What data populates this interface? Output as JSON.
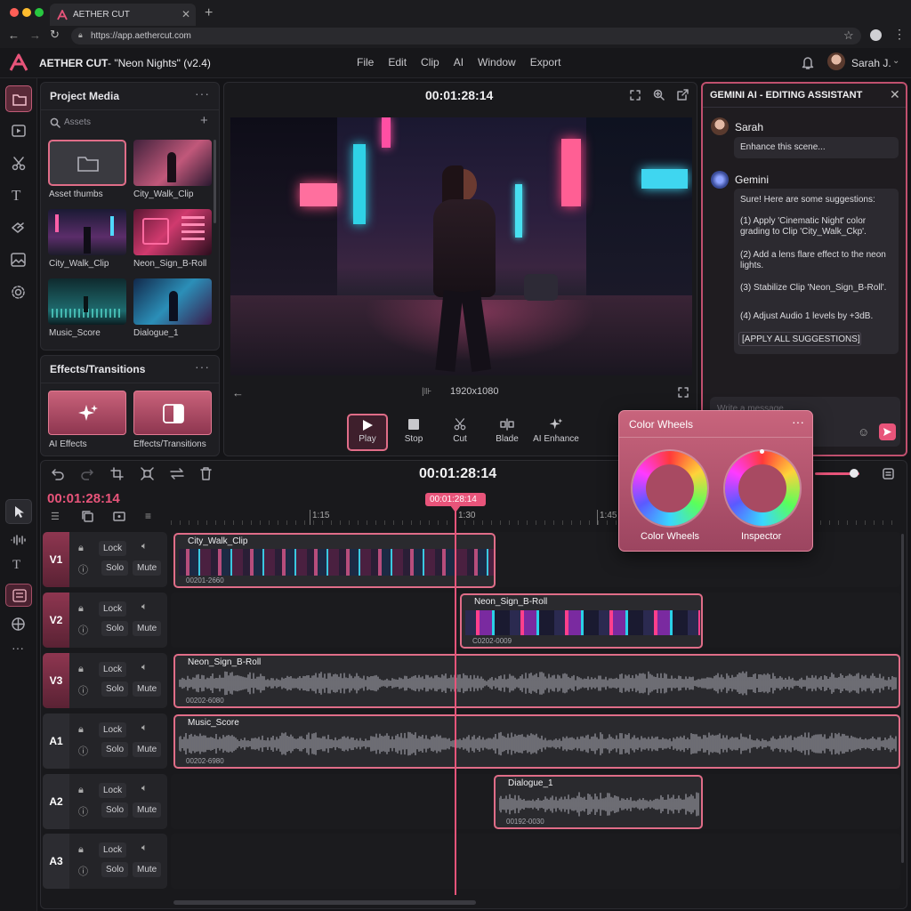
{
  "browser": {
    "tab_title": "AETHER CUT",
    "url": "https://app.aethercut.com"
  },
  "app": {
    "name": "AETHER CUT",
    "project": "- \"Neon Nights\" (v2.4)",
    "menu": [
      "File",
      "Edit",
      "Clip",
      "AI",
      "Window",
      "Export"
    ],
    "user": "Sarah J."
  },
  "media": {
    "title": "Project Media",
    "search_placeholder": "Assets",
    "items": [
      "Asset thumbs",
      "City_Walk_Clip",
      "City_Walk_Clip",
      "Neon_Sign_B-Roll",
      "Music_Score",
      "Dialogue_1"
    ]
  },
  "effects": {
    "title": "Effects/Transitions",
    "items": [
      "AI Effects",
      "Effects/Transitions"
    ]
  },
  "preview": {
    "timecode": "00:01:28:14",
    "resolution": "1920x1080",
    "controls": [
      "Play",
      "Stop",
      "Cut",
      "Blade",
      "AI Enhance"
    ]
  },
  "assistant": {
    "title": "GEMINI AI - EDITING ASSISTANT",
    "user_name": "Sarah",
    "user_msg": "Enhance this scene...",
    "bot_name": "Gemini",
    "bot_intro": "Sure! Here are some suggestions:",
    "suggestions": [
      "(1) Apply 'Cinematic Night' color grading to Clip 'City_Walk_Ckp'.",
      "(2) Add a lens flare effect to the neon lights.",
      "(3) Stabilize Clip 'Neon_Sign_B-Roll'.",
      "(4) Adjust Audio 1 levels by +3dB."
    ],
    "apply_all": "[APPLY ALL SUGGESTIONS]",
    "input_placeholder": "Write a message..."
  },
  "colorwheels": {
    "title": "Color Wheels",
    "wheel_labels": [
      "Color Wheels",
      "Inspector"
    ]
  },
  "timeline": {
    "timecode": "00:01:28:14",
    "current": "00:01:28:14",
    "playhead": "00:01:28:14",
    "ruler": [
      "1:15",
      "1:30",
      "1:45"
    ],
    "tracks": [
      {
        "name": "V1",
        "lock": "Lock",
        "solo": "Solo",
        "mute": "Mute"
      },
      {
        "name": "V2",
        "lock": "Lock",
        "solo": "Solo",
        "mute": "Mute"
      },
      {
        "name": "V3",
        "lock": "Lock",
        "solo": "Solo",
        "mute": "Mute"
      },
      {
        "name": "A1",
        "lock": "Lock",
        "solo": "Solo",
        "mute": "Mute"
      },
      {
        "name": "A2",
        "lock": "Lock",
        "solo": "Solo",
        "mute": "Mute"
      },
      {
        "name": "A3",
        "lock": "Lock",
        "solo": "Solo",
        "mute": "Mute"
      }
    ],
    "clips": [
      {
        "name": "City_Walk_Clip",
        "code": "00201-2660"
      },
      {
        "name": "Neon_Sign_B-Roll",
        "code": "C0202-0009"
      },
      {
        "name": "Neon_Sign_B-Roll",
        "code": "00202-6080"
      },
      {
        "name": "Music_Score",
        "code": "00202-6980"
      },
      {
        "name": "Dialogue_1",
        "code": "00192-0030"
      }
    ]
  },
  "colors": {
    "accent": "#e8547a",
    "accent_light": "#f08aa2",
    "panel": "#1e1e22"
  }
}
